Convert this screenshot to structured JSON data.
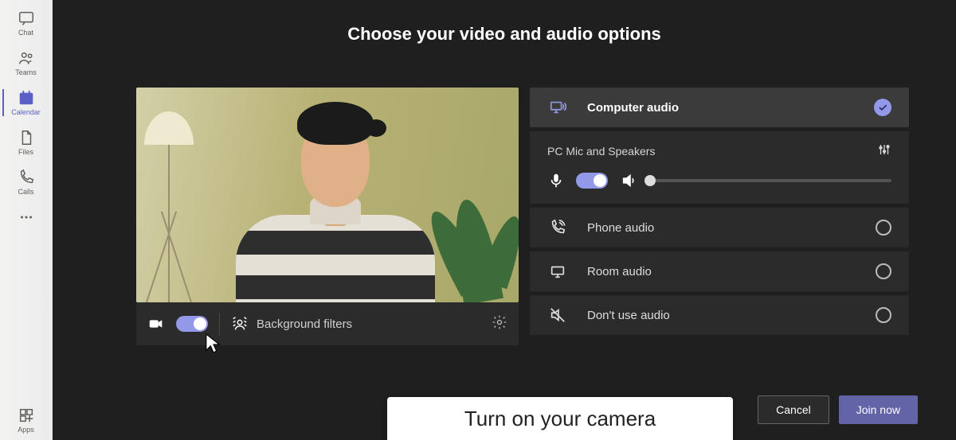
{
  "sidebar": {
    "items": [
      {
        "label": "Chat"
      },
      {
        "label": "Teams"
      },
      {
        "label": "Calendar"
      },
      {
        "label": "Files"
      },
      {
        "label": "Calls"
      }
    ],
    "apps_label": "Apps"
  },
  "heading": "Choose your video and audio options",
  "video": {
    "background_filters_label": "Background filters"
  },
  "audio": {
    "options": {
      "computer": "Computer audio",
      "phone": "Phone audio",
      "room": "Room audio",
      "none": "Don't use audio"
    },
    "device_label": "PC Mic and Speakers"
  },
  "buttons": {
    "cancel": "Cancel",
    "join": "Join now"
  },
  "tooltip": "Turn on your camera",
  "colors": {
    "accent": "#6264a7"
  }
}
